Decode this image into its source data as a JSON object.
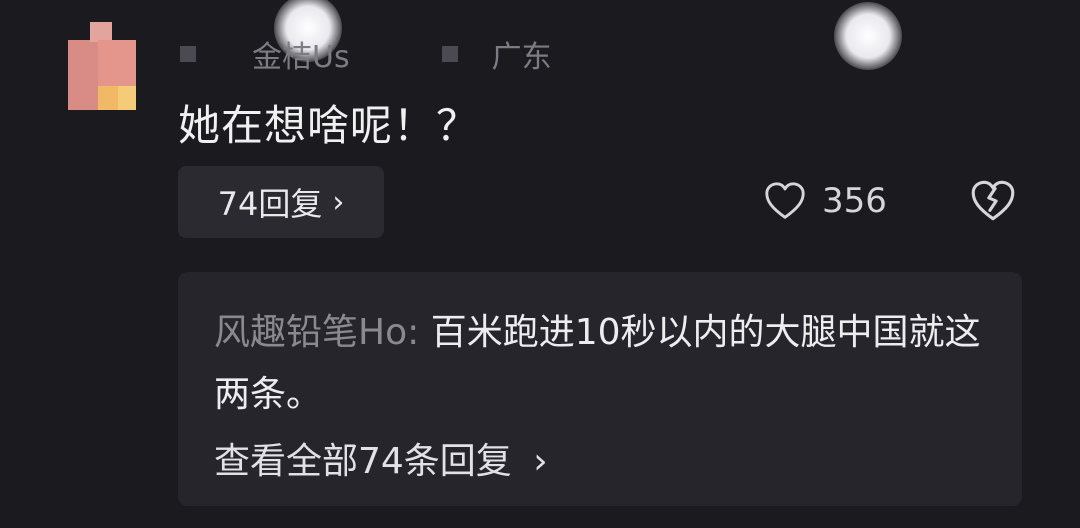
{
  "comment": {
    "username": "金桔Us",
    "location": "广东",
    "text": "她在想啥呢！？",
    "reply_button_label": "74回复",
    "like_count": "356",
    "icons": {
      "reply_chevron": "chevron-right-icon",
      "like": "heart-icon",
      "dislike": "broken-heart-icon"
    }
  },
  "top_reply": {
    "author": "风趣铅笔Ho:",
    "text": "百米跑进10秒以内的大腿中国就这两条。",
    "view_all_label": "查看全部74条回复"
  },
  "colors": {
    "background": "#1b1a1f",
    "panel": "#26252b",
    "muted_text": "#7d7c84"
  }
}
